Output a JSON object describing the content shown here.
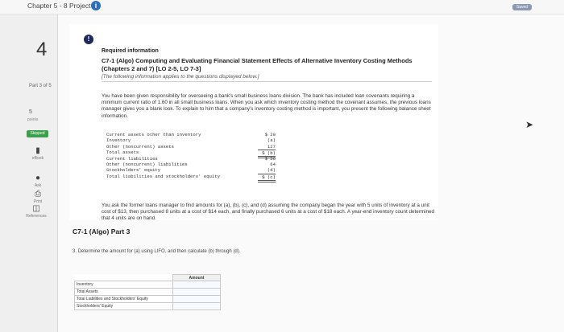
{
  "window": {
    "title": "Chapter 5 - 8 Project",
    "saved_label": "Saved"
  },
  "sidebar": {
    "question_number": "4",
    "part": "Part 3 of 5",
    "points": "5",
    "points_label": "points",
    "status": "Skipped",
    "buttons": [
      {
        "icon": "ebook-icon",
        "label": "eBook"
      },
      {
        "icon": "ask-icon",
        "label": "Ask"
      },
      {
        "icon": "print-icon",
        "label": "Print"
      },
      {
        "icon": "references-icon",
        "label": "References"
      }
    ]
  },
  "problem": {
    "badge": "!",
    "required_label": "Required information",
    "heading": "C7-1 (Algo) Computing and Evaluating Financial Statement Effects of Alternative Inventory Costing Methods (Chapters 2 and 7) [LO 2-5, LO 7-3]",
    "note": "[The following information applies to the questions displayed below.]",
    "paragraph1": "You have been given responsibility for overseeing a bank's small business loans division. The bank has included loan covenants requiring a minimum current ratio of 1.60 in all small business loans. When you ask which inventory costing method the covenant assumes, the previous loans manager gives you a blank look. To explain to him that a company's inventory costing method is important, you present the following balance sheet information.",
    "balance_sheet": [
      {
        "label": "Current assets other than inventory",
        "value": "$ 20",
        "indent": 0,
        "rule": ""
      },
      {
        "label": "Inventory",
        "value": "(a)",
        "indent": 0,
        "rule": ""
      },
      {
        "label": "Other (noncurrent) assets",
        "value": "127",
        "indent": 0,
        "rule": ""
      },
      {
        "label": "Total assets",
        "value": "$ (b)",
        "indent": 0,
        "rule": "dbl"
      },
      {
        "label": "Current liabilities",
        "value": "$ 56",
        "indent": 0,
        "rule": ""
      },
      {
        "label": "Other (noncurrent) liabilities",
        "value": "64",
        "indent": 0,
        "rule": ""
      },
      {
        "label": "Stockholders' equity",
        "value": "(d)",
        "indent": 0,
        "rule": ""
      },
      {
        "label": "Total liabilities and stockholders' equity",
        "value": "$ (c)",
        "indent": 0,
        "rule": "dbl"
      }
    ],
    "paragraph2": "You ask the former loans manager to find amounts for (a), (b), (c), and (d) assuming the company began the year with 5 units of inventory at a unit cost of $13, then purchased 8 units at a cost of $14 each, and finally purchased 6 units at a cost of $18 each. A year-end inventory count determined that 4 units are on hand."
  },
  "part3": {
    "title": "C7-1 (Algo) Part 3",
    "instruction": "3. Determine the amount for (a) using LIFO, and then calculate (b) through (d).",
    "table": {
      "header": "Amount",
      "rows": [
        {
          "label": "Inventory",
          "amount": ""
        },
        {
          "label": "Total Assets",
          "amount": ""
        },
        {
          "label": "Total Liabilities and Stockholders' Equity",
          "amount": ""
        },
        {
          "label": "Stockholders' Equity",
          "amount": ""
        }
      ]
    }
  }
}
